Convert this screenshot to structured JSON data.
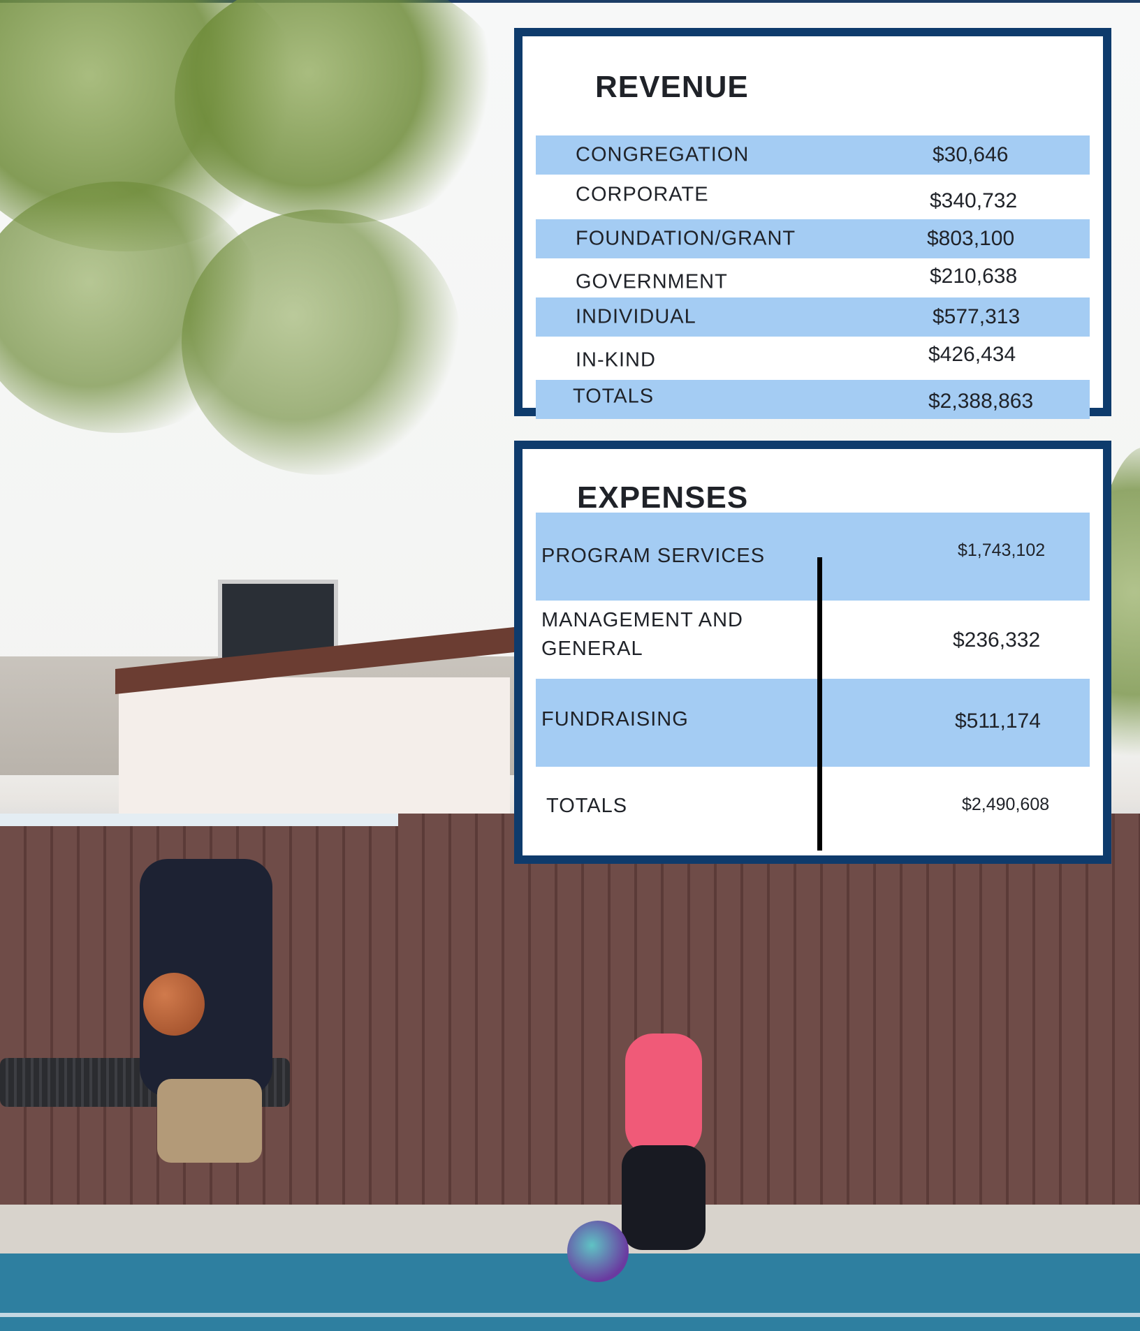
{
  "revenue": {
    "title": "REVENUE",
    "rows": [
      {
        "label": "CONGREGATION",
        "value": "$30,646"
      },
      {
        "label": "CORPORATE",
        "value": "$340,732"
      },
      {
        "label": "FOUNDATION/GRANT",
        "value": "$803,100"
      },
      {
        "label": "GOVERNMENT",
        "value": "$210,638"
      },
      {
        "label": "INDIVIDUAL",
        "value": "$577,313"
      },
      {
        "label": "IN-KIND",
        "value": "$426,434"
      },
      {
        "label": "TOTALS",
        "value": "$2,388,863"
      }
    ]
  },
  "expenses": {
    "title": "EXPENSES",
    "rows": [
      {
        "label": "PROGRAM SERVICES",
        "value": "$1,743,102"
      },
      {
        "label": "MANAGEMENT AND GENERAL",
        "value": "$236,332"
      },
      {
        "label": "FUNDRAISING",
        "value": "$511,174"
      },
      {
        "label": "TOTALS",
        "value": "$2,490,608"
      }
    ]
  },
  "colors": {
    "panel_border": "#0e3b6c",
    "row_shade": "#a4ccf3",
    "text": "#1f2228"
  }
}
